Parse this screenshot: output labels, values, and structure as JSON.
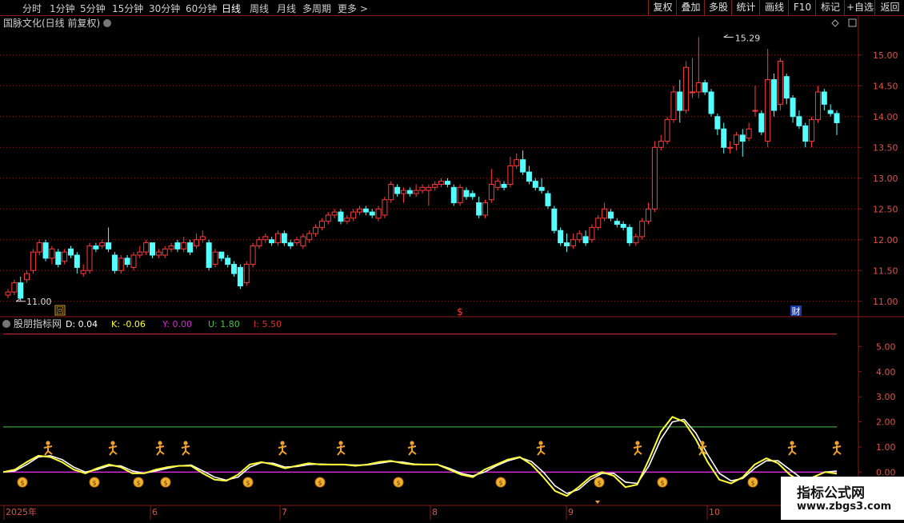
{
  "toolbar": {
    "tabs": [
      "分时",
      "1分钟",
      "5分钟",
      "15分钟",
      "30分钟",
      "60分钟",
      "日线",
      "周线",
      "月线",
      "多周期",
      "更多 >"
    ],
    "active_tab": "日线",
    "tools": [
      "复权",
      "叠加",
      "多股",
      "统计",
      "画线",
      "F10",
      "标记",
      "+自选",
      "返回"
    ]
  },
  "chart_title": "国脉文化(日线 前复权)",
  "colors": {
    "up": "#ff3b3b",
    "down": "#54ffff",
    "grid": "#8b1a1a",
    "K": "#ffff3c",
    "D": "#ffffff",
    "purple": "#d82bd8",
    "green": "#43c443",
    "red_line": "#e03030",
    "axis_text": "#d8554a"
  },
  "price_axis": {
    "ticks": [
      "15.00",
      "14.50",
      "14.00",
      "13.50",
      "13.00",
      "12.50",
      "12.00",
      "11.50",
      "11.00"
    ]
  },
  "annotations": {
    "high": "15.29",
    "low": "11.00",
    "event1": "回",
    "event2": "$",
    "event3": "财"
  },
  "indicator": {
    "name": "股朋指标网",
    "values": [
      {
        "label": "D: 0.04",
        "color": "#ffffff"
      },
      {
        "label": "K: -0.06",
        "color": "#ffff3c"
      },
      {
        "label": "Y: 0.00",
        "color": "#d82bd8"
      },
      {
        "label": "U: 1.80",
        "color": "#43c443"
      },
      {
        "label": "I: 5.50",
        "color": "#e03030"
      }
    ],
    "ticks": [
      "5.00",
      "4.00",
      "3.00",
      "2.00",
      "1.00",
      "0.00"
    ]
  },
  "x_axis": {
    "labels": [
      "2025年",
      "6",
      "7",
      "8",
      "9",
      "10"
    ]
  },
  "watermark": {
    "line1": "指标公式网",
    "line2": "www.zbgs3.com"
  },
  "chart_data": {
    "type": "candlestick",
    "y_range": [
      10.75,
      15.4
    ],
    "indicator_range": [
      -1.2,
      6.0
    ],
    "candles": [
      [
        11.1,
        11.15,
        11.05,
        11.2
      ],
      [
        11.15,
        11.3,
        11.1,
        11.35
      ],
      [
        11.3,
        11.05,
        11.0,
        11.4
      ],
      [
        11.35,
        11.45,
        11.3,
        11.5
      ],
      [
        11.5,
        11.8,
        11.45,
        11.85
      ],
      [
        11.8,
        11.95,
        11.75,
        12.0
      ],
      [
        11.95,
        11.7,
        11.65,
        12.0
      ],
      [
        11.7,
        11.85,
        11.6,
        11.9
      ],
      [
        11.8,
        11.6,
        11.55,
        11.85
      ],
      [
        11.65,
        11.8,
        11.6,
        11.85
      ],
      [
        11.85,
        11.75,
        11.7,
        11.9
      ],
      [
        11.75,
        11.55,
        11.45,
        11.8
      ],
      [
        11.45,
        11.5,
        11.4,
        11.6
      ],
      [
        11.5,
        11.9,
        11.45,
        11.95
      ],
      [
        11.9,
        11.85,
        11.8,
        11.95
      ],
      [
        11.9,
        11.95,
        11.85,
        12.0
      ],
      [
        11.95,
        11.85,
        11.8,
        12.2
      ],
      [
        11.75,
        11.5,
        11.45,
        11.8
      ],
      [
        11.5,
        11.7,
        11.45,
        11.75
      ],
      [
        11.7,
        11.6,
        11.55,
        11.75
      ],
      [
        11.55,
        11.75,
        11.5,
        11.8
      ],
      [
        11.75,
        11.8,
        11.7,
        11.9
      ],
      [
        11.8,
        11.95,
        11.75,
        12.0
      ],
      [
        11.95,
        11.75,
        11.7,
        11.95
      ],
      [
        11.75,
        11.8,
        11.7,
        11.85
      ],
      [
        11.75,
        11.85,
        11.7,
        11.9
      ],
      [
        11.85,
        11.9,
        11.8,
        11.95
      ],
      [
        11.95,
        11.85,
        11.8,
        12.0
      ],
      [
        11.85,
        11.95,
        11.8,
        12.05
      ],
      [
        11.95,
        11.8,
        11.75,
        12.0
      ],
      [
        11.9,
        12.0,
        11.85,
        12.1
      ],
      [
        12.0,
        12.05,
        11.95,
        12.15
      ],
      [
        11.95,
        11.55,
        11.5,
        12.0
      ],
      [
        11.6,
        11.8,
        11.55,
        11.85
      ],
      [
        11.8,
        11.7,
        11.65,
        11.8
      ],
      [
        11.7,
        11.6,
        11.55,
        11.75
      ],
      [
        11.6,
        11.45,
        11.4,
        11.65
      ],
      [
        11.55,
        11.25,
        11.2,
        11.6
      ],
      [
        11.3,
        11.6,
        11.25,
        11.65
      ],
      [
        11.6,
        11.9,
        11.55,
        11.95
      ],
      [
        11.9,
        12.0,
        11.85,
        12.05
      ],
      [
        12.0,
        12.05,
        11.95,
        12.1
      ],
      [
        12.0,
        11.95,
        11.9,
        12.05
      ],
      [
        11.95,
        12.1,
        11.9,
        12.15
      ],
      [
        12.1,
        11.95,
        11.9,
        12.15
      ],
      [
        11.95,
        11.9,
        11.85,
        12.0
      ],
      [
        11.95,
        12.0,
        11.9,
        12.05
      ],
      [
        11.9,
        12.05,
        11.85,
        12.1
      ],
      [
        12.0,
        12.1,
        11.95,
        12.15
      ],
      [
        12.1,
        12.2,
        12.05,
        12.25
      ],
      [
        12.2,
        12.3,
        12.15,
        12.35
      ],
      [
        12.3,
        12.4,
        12.25,
        12.45
      ],
      [
        12.4,
        12.45,
        12.35,
        12.5
      ],
      [
        12.45,
        12.3,
        12.25,
        12.5
      ],
      [
        12.3,
        12.35,
        12.25,
        12.4
      ],
      [
        12.35,
        12.45,
        12.3,
        12.5
      ],
      [
        12.45,
        12.5,
        12.4,
        12.55
      ],
      [
        12.5,
        12.45,
        12.4,
        12.55
      ],
      [
        12.45,
        12.4,
        12.35,
        12.5
      ],
      [
        12.35,
        12.5,
        12.3,
        12.55
      ],
      [
        12.4,
        12.65,
        12.35,
        12.7
      ],
      [
        12.65,
        12.9,
        12.6,
        12.95
      ],
      [
        12.85,
        12.75,
        12.7,
        12.9
      ],
      [
        12.75,
        12.8,
        12.6,
        12.85
      ],
      [
        12.8,
        12.75,
        12.7,
        12.85
      ],
      [
        12.75,
        12.8,
        12.7,
        12.9
      ],
      [
        12.8,
        12.85,
        12.75,
        12.9
      ],
      [
        12.8,
        12.85,
        12.55,
        12.9
      ],
      [
        12.85,
        12.9,
        12.8,
        12.95
      ],
      [
        12.9,
        12.95,
        12.85,
        13.0
      ],
      [
        12.95,
        12.9,
        12.85,
        13.0
      ],
      [
        12.85,
        12.6,
        12.55,
        12.9
      ],
      [
        12.6,
        12.85,
        12.55,
        12.9
      ],
      [
        12.8,
        12.7,
        12.65,
        12.85
      ],
      [
        12.75,
        12.7,
        12.65,
        12.8
      ],
      [
        12.6,
        12.4,
        12.35,
        12.7
      ],
      [
        12.4,
        12.6,
        12.35,
        12.65
      ],
      [
        12.65,
        12.9,
        12.6,
        13.15
      ],
      [
        12.85,
        12.95,
        12.8,
        13.0
      ],
      [
        12.9,
        12.85,
        12.8,
        12.95
      ],
      [
        12.9,
        13.2,
        12.85,
        13.35
      ],
      [
        13.2,
        13.3,
        13.15,
        13.4
      ],
      [
        13.3,
        13.1,
        13.05,
        13.45
      ],
      [
        13.1,
        12.95,
        12.9,
        13.2
      ],
      [
        12.95,
        12.85,
        12.8,
        13.0
      ],
      [
        12.85,
        12.8,
        12.75,
        13.0
      ],
      [
        12.75,
        12.55,
        12.5,
        12.8
      ],
      [
        12.5,
        12.15,
        12.1,
        12.55
      ],
      [
        12.15,
        11.95,
        11.9,
        12.2
      ],
      [
        11.95,
        11.9,
        11.8,
        12.1
      ],
      [
        11.9,
        12.0,
        11.85,
        12.1
      ],
      [
        12.0,
        12.1,
        11.95,
        12.15
      ],
      [
        12.05,
        11.95,
        11.9,
        12.15
      ],
      [
        12.0,
        12.2,
        11.95,
        12.25
      ],
      [
        12.2,
        12.35,
        12.15,
        12.4
      ],
      [
        12.35,
        12.5,
        12.3,
        12.6
      ],
      [
        12.45,
        12.35,
        12.3,
        12.5
      ],
      [
        12.3,
        12.25,
        12.2,
        12.35
      ],
      [
        12.25,
        12.2,
        12.15,
        12.3
      ],
      [
        12.2,
        11.95,
        11.9,
        12.25
      ],
      [
        11.95,
        12.05,
        11.9,
        12.1
      ],
      [
        12.05,
        12.3,
        12.0,
        12.35
      ],
      [
        12.3,
        12.5,
        12.25,
        12.6
      ],
      [
        12.5,
        13.5,
        12.45,
        13.6
      ],
      [
        13.5,
        13.6,
        13.45,
        13.7
      ],
      [
        13.6,
        13.95,
        13.55,
        14.0
      ],
      [
        13.95,
        14.4,
        13.9,
        14.5
      ],
      [
        14.4,
        14.1,
        13.9,
        14.6
      ],
      [
        14.1,
        14.8,
        14.05,
        14.9
      ],
      [
        14.4,
        14.4,
        14.3,
        14.95
      ],
      [
        14.4,
        14.55,
        14.3,
        15.29
      ],
      [
        14.55,
        14.4,
        14.35,
        14.6
      ],
      [
        14.4,
        14.05,
        14.0,
        14.45
      ],
      [
        14.0,
        13.8,
        13.7,
        14.05
      ],
      [
        13.8,
        13.5,
        13.4,
        13.9
      ],
      [
        13.5,
        13.5,
        13.4,
        13.6
      ],
      [
        13.55,
        13.7,
        13.45,
        13.75
      ],
      [
        13.7,
        13.6,
        13.35,
        13.8
      ],
      [
        13.65,
        13.8,
        13.6,
        13.9
      ],
      [
        14.1,
        14.1,
        14.0,
        14.5
      ],
      [
        14.05,
        13.75,
        13.7,
        14.1
      ],
      [
        13.6,
        14.6,
        13.5,
        15.1
      ],
      [
        14.6,
        14.1,
        14.0,
        14.7
      ],
      [
        14.2,
        14.9,
        14.1,
        14.95
      ],
      [
        14.65,
        14.3,
        14.2,
        14.7
      ],
      [
        14.3,
        14.0,
        13.9,
        14.35
      ],
      [
        14.0,
        13.85,
        13.8,
        14.1
      ],
      [
        13.85,
        13.6,
        13.5,
        13.9
      ],
      [
        13.6,
        13.95,
        13.5,
        14.0
      ],
      [
        13.95,
        14.4,
        13.9,
        14.5
      ],
      [
        14.4,
        14.2,
        14.1,
        14.45
      ],
      [
        14.1,
        14.05,
        14.0,
        14.2
      ],
      [
        14.05,
        13.9,
        13.7,
        14.1
      ]
    ],
    "K": [
      0.0,
      0.1,
      0.4,
      0.65,
      0.6,
      0.4,
      0.1,
      -0.05,
      0.15,
      0.3,
      0.2,
      -0.05,
      -0.05,
      0.1,
      0.2,
      0.25,
      0.25,
      -0.05,
      -0.3,
      -0.35,
      -0.1,
      0.3,
      0.4,
      0.3,
      0.15,
      0.25,
      0.35,
      0.3,
      0.3,
      0.3,
      0.25,
      0.3,
      0.4,
      0.45,
      0.35,
      0.3,
      0.3,
      0.3,
      0.1,
      -0.1,
      -0.2,
      0.1,
      0.3,
      0.5,
      0.6,
      0.3,
      -0.2,
      -0.75,
      -0.95,
      -0.6,
      -0.2,
      0.0,
      -0.15,
      -0.6,
      -0.5,
      0.5,
      1.6,
      2.2,
      2.0,
      1.3,
      0.4,
      -0.3,
      -0.45,
      -0.2,
      0.3,
      0.55,
      0.35,
      -0.1,
      -0.4,
      -0.2,
      0.0,
      -0.06
    ],
    "D": [
      0.0,
      0.05,
      0.3,
      0.6,
      0.65,
      0.5,
      0.2,
      0.0,
      0.1,
      0.25,
      0.25,
      0.05,
      -0.05,
      0.05,
      0.15,
      0.25,
      0.28,
      0.05,
      -0.2,
      -0.32,
      -0.2,
      0.2,
      0.38,
      0.35,
      0.2,
      0.22,
      0.3,
      0.32,
      0.3,
      0.3,
      0.28,
      0.28,
      0.35,
      0.42,
      0.4,
      0.32,
      0.3,
      0.3,
      0.15,
      -0.05,
      -0.15,
      0.0,
      0.25,
      0.45,
      0.58,
      0.42,
      0.0,
      -0.55,
      -0.85,
      -0.7,
      -0.3,
      -0.05,
      -0.05,
      -0.4,
      -0.45,
      0.25,
      1.3,
      2.0,
      2.1,
      1.55,
      0.7,
      -0.05,
      -0.35,
      -0.25,
      0.15,
      0.45,
      0.45,
      0.1,
      -0.25,
      -0.2,
      0.0,
      0.04
    ],
    "Y": 0.0,
    "U": 1.8,
    "I": 5.5,
    "buy_markers_x": [
      60,
      141,
      200,
      232,
      353,
      426,
      515,
      676,
      797,
      878,
      990,
      1046
    ],
    "sell_markers_x": [
      28,
      118,
      173,
      207,
      310,
      400,
      498,
      626,
      749,
      828,
      941
    ]
  }
}
